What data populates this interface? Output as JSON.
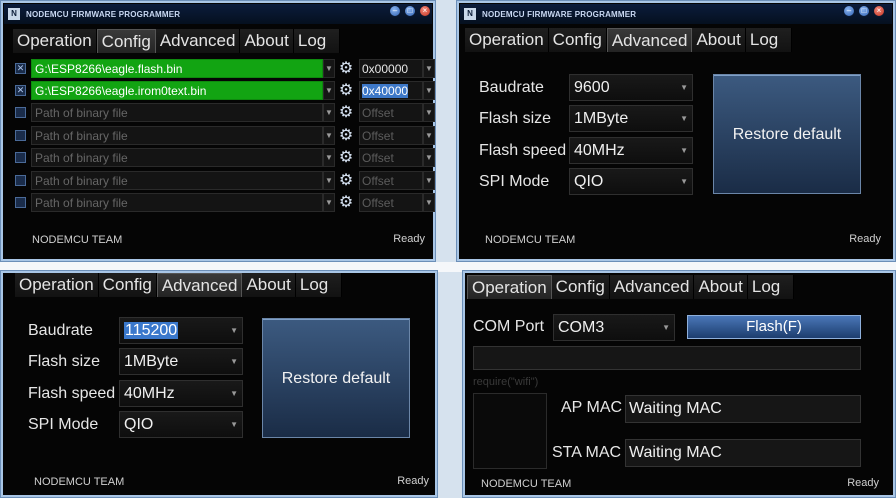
{
  "app": {
    "title": "NODEMCU FIRMWARE PROGRAMMER",
    "footer": "NODEMCU TEAM",
    "status": "Ready"
  },
  "tabs": {
    "operation": "Operation",
    "config": "Config",
    "advanced": "Advanced",
    "about": "About",
    "log": "Log"
  },
  "config": {
    "rows": [
      {
        "checked": true,
        "path": "G:\\ESP8266\\eagle.flash.bin",
        "offset": "0x00000"
      },
      {
        "checked": true,
        "path": "G:\\ESP8266\\eagle.irom0text.bin",
        "offset": "0x40000"
      },
      {
        "checked": false,
        "path": "Path of binary file",
        "offset": "Offset"
      },
      {
        "checked": false,
        "path": "Path of binary file",
        "offset": "Offset"
      },
      {
        "checked": false,
        "path": "Path of binary file",
        "offset": "Offset"
      },
      {
        "checked": false,
        "path": "Path of binary file",
        "offset": "Offset"
      },
      {
        "checked": false,
        "path": "Path of binary file",
        "offset": "Offset"
      }
    ]
  },
  "advanced_a": {
    "labels": {
      "baudrate": "Baudrate",
      "flash_size": "Flash size",
      "flash_speed": "Flash speed",
      "spi_mode": "SPI Mode"
    },
    "values": {
      "baudrate": "9600",
      "flash_size": "1MByte",
      "flash_speed": "40MHz",
      "spi_mode": "QIO"
    },
    "restore": "Restore default"
  },
  "advanced_b": {
    "values": {
      "baudrate": "115200",
      "flash_size": "1MByte",
      "flash_speed": "40MHz",
      "spi_mode": "QIO"
    },
    "restore": "Restore default"
  },
  "operation": {
    "com_label": "COM Port",
    "com_value": "COM3",
    "flash_button": "Flash(F)",
    "require_text": "require(\"wifi\")",
    "ap_label": "AP MAC",
    "ap_value": "Waiting MAC",
    "sta_label": "STA MAC",
    "sta_value": "Waiting MAC"
  },
  "icons": {
    "checkbox": "check-icon",
    "dropdown": "chevron-down-icon",
    "offset": "gear-icon"
  },
  "colors": {
    "path_active": "#12a412",
    "button_accent": "#3c5a80",
    "selection": "#3a78cc"
  }
}
